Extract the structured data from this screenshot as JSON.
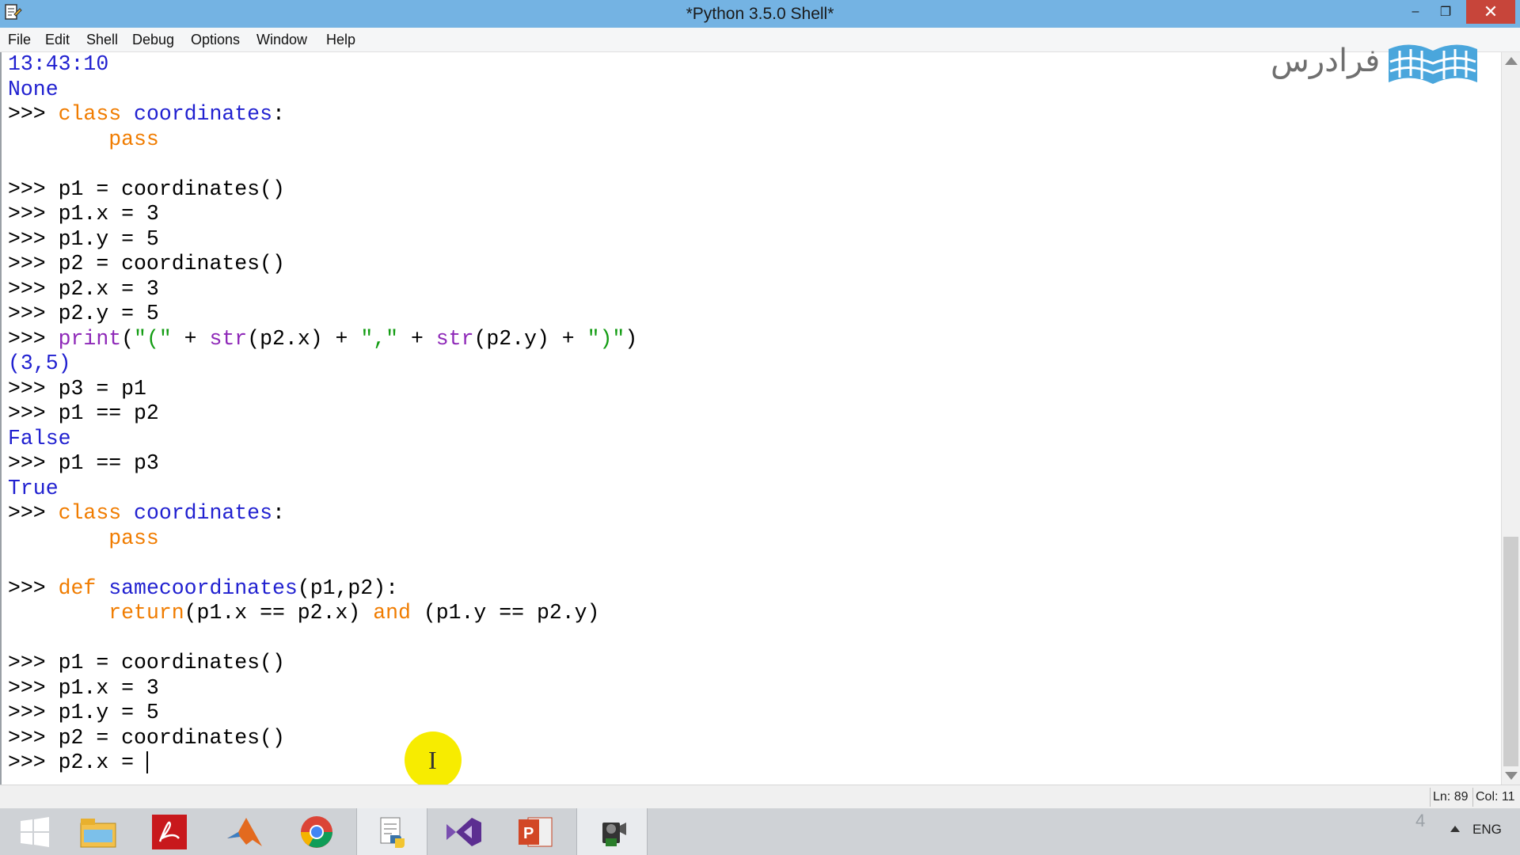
{
  "window": {
    "title": "*Python 3.5.0 Shell*",
    "minimize_glyph": "–",
    "maximize_glyph": "❐",
    "close_glyph": "✕"
  },
  "menu": [
    "File",
    "Edit",
    "Shell",
    "Debug",
    "Options",
    "Window",
    "Help"
  ],
  "watermark": {
    "text": "فرادرس",
    "icon": "book-logo-icon"
  },
  "shell_lines": [
    [
      {
        "t": "13:43:10",
        "c": "out"
      }
    ],
    [
      {
        "t": "None",
        "c": "out"
      }
    ],
    [
      {
        "t": ">>> "
      },
      {
        "t": "class",
        "c": "kw"
      },
      {
        "t": " "
      },
      {
        "t": "coordinates",
        "c": "def"
      },
      {
        "t": ":"
      }
    ],
    [
      {
        "t": "\tpass",
        "c": "kw"
      }
    ],
    [],
    [
      {
        "t": ">>> p1 = coordinates()"
      }
    ],
    [
      {
        "t": ">>> p1.x = 3"
      }
    ],
    [
      {
        "t": ">>> p1.y = 5"
      }
    ],
    [
      {
        "t": ">>> p2 = coordinates()"
      }
    ],
    [
      {
        "t": ">>> p2.x = 3"
      }
    ],
    [
      {
        "t": ">>> p2.y = 5"
      }
    ],
    [
      {
        "t": ">>> "
      },
      {
        "t": "print",
        "c": "bi"
      },
      {
        "t": "("
      },
      {
        "t": "\"(\"",
        "c": "str"
      },
      {
        "t": " + "
      },
      {
        "t": "str",
        "c": "bi"
      },
      {
        "t": "(p2.x) + "
      },
      {
        "t": "\",\"",
        "c": "str"
      },
      {
        "t": " + "
      },
      {
        "t": "str",
        "c": "bi"
      },
      {
        "t": "(p2.y) + "
      },
      {
        "t": "\")\"",
        "c": "str"
      },
      {
        "t": ")"
      }
    ],
    [
      {
        "t": "(3,5)",
        "c": "out"
      }
    ],
    [
      {
        "t": ">>> p3 = p1"
      }
    ],
    [
      {
        "t": ">>> p1 == p2"
      }
    ],
    [
      {
        "t": "False",
        "c": "out"
      }
    ],
    [
      {
        "t": ">>> p1 == p3"
      }
    ],
    [
      {
        "t": "True",
        "c": "out"
      }
    ],
    [
      {
        "t": ">>> "
      },
      {
        "t": "class",
        "c": "kw"
      },
      {
        "t": " "
      },
      {
        "t": "coordinates",
        "c": "def"
      },
      {
        "t": ":"
      }
    ],
    [
      {
        "t": "\tpass",
        "c": "kw"
      }
    ],
    [],
    [
      {
        "t": ">>> "
      },
      {
        "t": "def",
        "c": "kw"
      },
      {
        "t": " "
      },
      {
        "t": "samecoordinates",
        "c": "def"
      },
      {
        "t": "(p1,p2):"
      }
    ],
    [
      {
        "t": "\t"
      },
      {
        "t": "return",
        "c": "kw"
      },
      {
        "t": "(p1.x == p2.x) "
      },
      {
        "t": "and",
        "c": "kw"
      },
      {
        "t": " (p1.y == p2.y)"
      }
    ],
    [],
    [
      {
        "t": ">>> p1 = coordinates()"
      }
    ],
    [
      {
        "t": ">>> p1.x = 3"
      }
    ],
    [
      {
        "t": ">>> p1.y = 5"
      }
    ],
    [
      {
        "t": ">>> p2 = coordinates()"
      }
    ],
    [
      {
        "t": ">>> p2.x = "
      }
    ]
  ],
  "status": {
    "line": "Ln: 89",
    "col": "Col: 11"
  },
  "taskbar": {
    "apps": [
      "windows-start-icon",
      "file-explorer-icon",
      "acrobat-reader-icon",
      "matlab-icon",
      "chrome-icon",
      "python-idle-icon",
      "visual-studio-icon",
      "powerpoint-icon",
      "camtasia-recorder-icon"
    ],
    "active_app": "python-idle-icon",
    "language": "ENG",
    "notification_count": "4"
  }
}
